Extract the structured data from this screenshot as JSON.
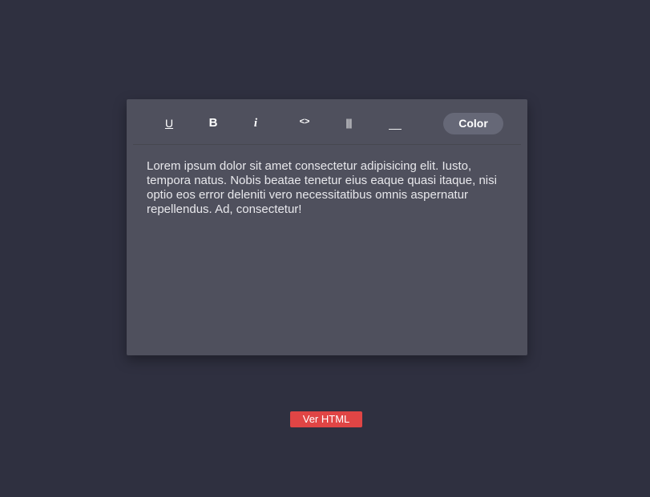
{
  "toolbar": {
    "underline_label": "U",
    "bold_label": "B",
    "italic_label": "i",
    "code_label": "<>",
    "columns_label": "|||",
    "line_label": "__",
    "color_label": "Color"
  },
  "editor": {
    "content": "Lorem ipsum dolor sit amet consectetur adipisicing elit. Iusto, tempora natus. Nobis beatae tenetur eius eaque quasi itaque, nisi optio eos error deleniti vero necessitatibus omnis aspernatur repellendus. Ad, consectetur!"
  },
  "actions": {
    "view_html_label": "Ver HTML"
  },
  "colors": {
    "background": "#2f3040",
    "editor_bg": "#4f505d",
    "color_button": "#666877",
    "accent": "#e04545"
  }
}
